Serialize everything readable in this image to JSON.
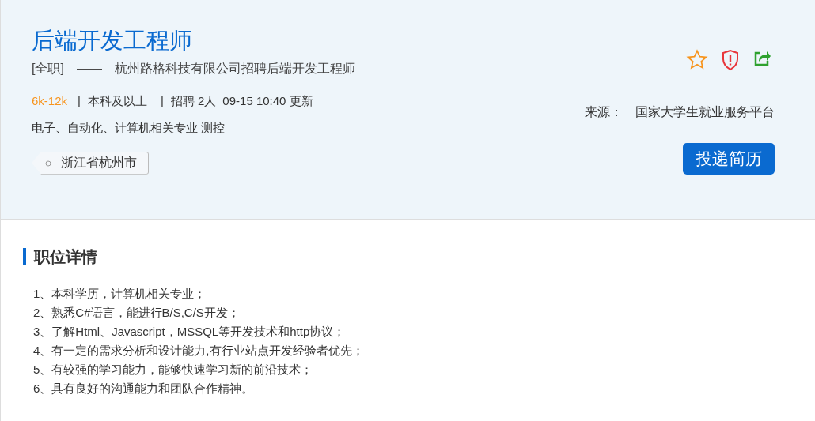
{
  "job": {
    "title": "后端开发工程师",
    "job_type": "[全职]",
    "dash": "——",
    "subtitle": "杭州路格科技有限公司招聘后端开发工程师",
    "meta": [
      {
        "kind": "salary",
        "text": "6k-12k"
      },
      {
        "kind": "separator",
        "text": "|"
      },
      {
        "kind": "plain",
        "text": "本科及以上"
      },
      {
        "kind": "separator",
        "text": "|"
      },
      {
        "kind": "plain",
        "text": "招聘 2人"
      },
      {
        "kind": "plain",
        "text": "09-15 10:40 更新"
      }
    ],
    "majors": "电子、自动化、计算机相关专业 测控",
    "location": "浙江省杭州市",
    "source_label": "来源：",
    "source": "国家大学生就业服务平台",
    "apply_button": "投递简历"
  },
  "details": {
    "heading": "职位详情",
    "items": [
      "1、本科学历，计算机相关专业；",
      "2、熟悉C#语言，能进行B/S,C/S开发；",
      "3、了解Html、Javascript，MSSQL等开发技术和http协议；",
      "4、有一定的需求分析和设计能力,有行业站点开发经验者优先；",
      "5、有较强的学习能力，能够快速学习新的前沿技术；",
      "6、具有良好的沟通能力和团队合作精神。"
    ]
  }
}
